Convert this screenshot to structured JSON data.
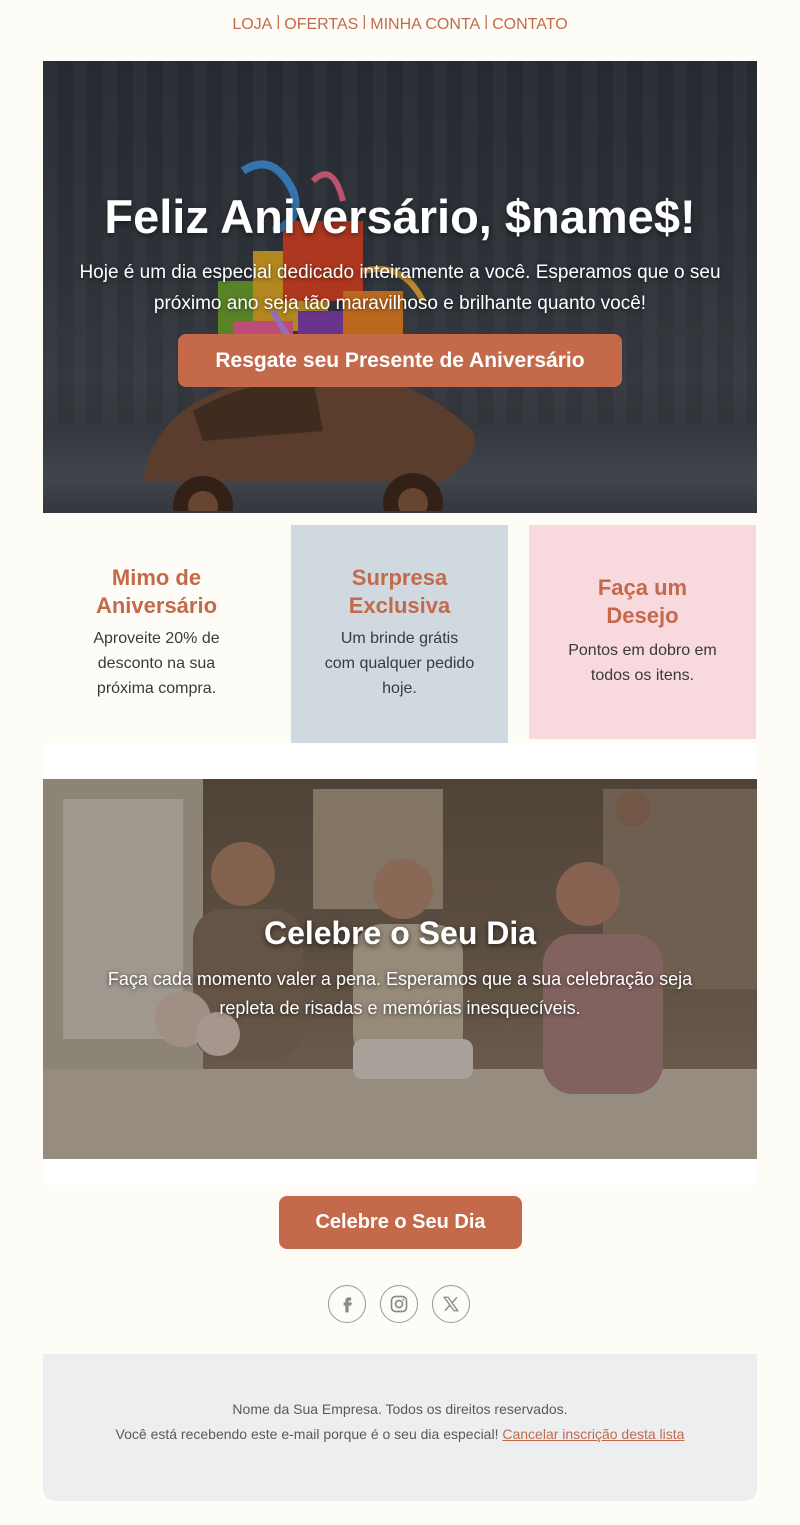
{
  "nav": {
    "items": [
      "LOJA",
      "OFERTAS",
      "MINHA CONTA",
      "CONTATO"
    ],
    "separator": "|"
  },
  "hero": {
    "title": "Feliz Aniversário, $name$!",
    "text": "Hoje é um dia especial dedicado inteiramente a você. Esperamos que o seu próximo ano seja tão maravilhoso e brilhante quanto você!",
    "button_label": "Resgate seu Presente de Aniversário",
    "image_icon": "toy-car-with-gifts-image"
  },
  "cards": [
    {
      "title": "Mimo de Aniversário",
      "text": "Aproveite 20% de desconto na sua próxima compra.",
      "bg": "#fdfcf7"
    },
    {
      "title": "Surpresa Exclusiva",
      "text": "Um brinde grátis com qualquer pedido hoje.",
      "bg": "#d0d9e0"
    },
    {
      "title": "Faça um Desejo",
      "text": "Pontos em dobro em todos os itens.",
      "bg": "#f8d9dd"
    }
  ],
  "celebrate": {
    "title": "Celebre o Seu Dia",
    "text": "Faça cada momento valer a pena. Esperamos que a sua celebração seja repleta de risadas e memórias inesquecíveis.",
    "image_icon": "birthday-party-photo"
  },
  "cta": {
    "label": "Celebre o Seu Dia"
  },
  "social": {
    "icons": [
      "facebook-icon",
      "instagram-icon",
      "x-icon"
    ]
  },
  "footer": {
    "line1": "Nome da Sua Empresa. Todos os direitos reservados.",
    "line2": "Você está recebendo este e-mail porque é o seu dia especial!",
    "unsubscribe": "Cancelar inscrição desta lista"
  },
  "colors": {
    "accent": "#c46a4b",
    "background": "#fdfcf7",
    "footer_bg": "#eceef0"
  }
}
